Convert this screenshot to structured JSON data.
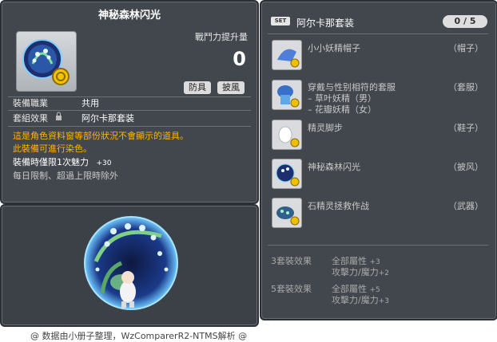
{
  "item_code": "01103587",
  "title": "神秘森林闪光",
  "power": {
    "label": "戰鬥力提升量",
    "value": "0"
  },
  "tags": [
    "防具",
    "披風"
  ],
  "job": {
    "label": "裝備職業",
    "value": "共用"
  },
  "set_effect": {
    "label": "套組效果",
    "value": "阿尔卡那套装"
  },
  "desc": {
    "orange1": "這是角色資料窗等部份狀況不會顯示的道具。",
    "orange2": "此裝備可進行染色。",
    "limit_label": "裝備時僅限1次魅力",
    "limit_value": "+30",
    "gray": "每日限制、超過上限時除外"
  },
  "set_panel": {
    "badge": "SET",
    "name": "阿尔卡那套装",
    "count": "0 / 5",
    "items": [
      {
        "name": "小小妖精帽子",
        "slot": "（帽子）",
        "icon": "hat-icon"
      },
      {
        "name": "穿戴与性别相符的套服",
        "slot": "（套服）",
        "sub1": "– 草叶妖精（男）",
        "sub2": "– 花瓣妖精（女）",
        "icon": "outfit-icon"
      },
      {
        "name": "精灵脚步",
        "slot": "（鞋子）",
        "icon": "shoes-icon"
      },
      {
        "name": "神秘森林闪光",
        "slot": "（披风）",
        "icon": "cape-icon"
      },
      {
        "name": "石精灵拯救作战",
        "slot": "（武器）",
        "icon": "weapon-icon"
      }
    ],
    "effects": [
      {
        "label": "3套裝效果",
        "line1": "全部屬性",
        "line1_val": "+3",
        "line2": "攻擊力/魔力",
        "line2_val": "+2"
      },
      {
        "label": "5套裝效果",
        "line1": "全部屬性",
        "line1_val": "+5",
        "line2": "攻擊力/魔力",
        "line2_val": "+3"
      }
    ]
  },
  "footer": "@ 数据由小册子整理，WzComparerR2-NTMS解析 @"
}
